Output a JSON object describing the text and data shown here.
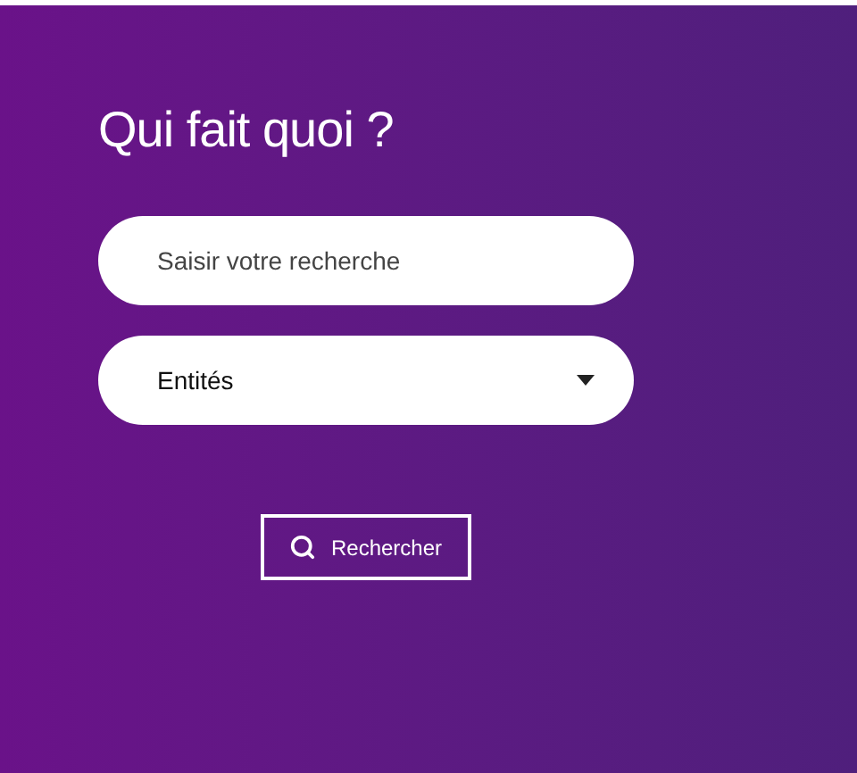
{
  "title": "Qui fait quoi ?",
  "search": {
    "placeholder": "Saisir votre recherche"
  },
  "select": {
    "value": "Entités"
  },
  "button": {
    "label": "Rechercher"
  }
}
